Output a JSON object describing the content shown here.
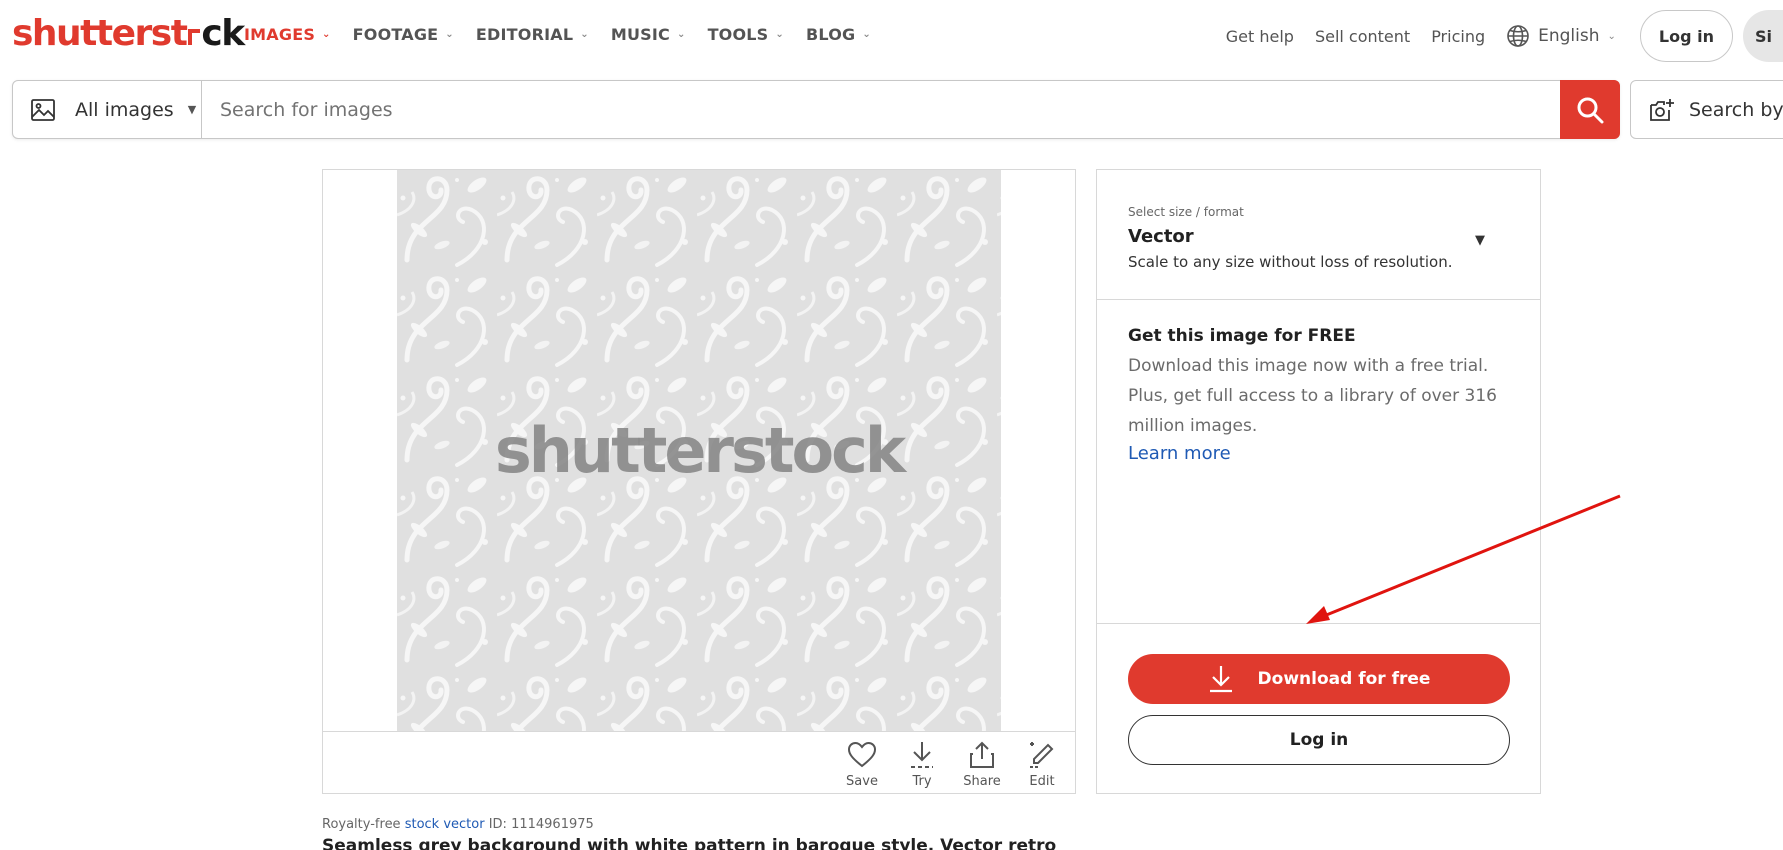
{
  "brand": {
    "logo_start": "shutterst",
    "logo_end": "ck",
    "accent": "#e03a2e"
  },
  "nav": {
    "items": [
      {
        "label": "IMAGES",
        "active": true
      },
      {
        "label": "FOOTAGE",
        "active": false
      },
      {
        "label": "EDITORIAL",
        "active": false
      },
      {
        "label": "MUSIC",
        "active": false
      },
      {
        "label": "TOOLS",
        "active": false
      },
      {
        "label": "BLOG",
        "active": false
      }
    ],
    "chevron": "⌄",
    "get_help": "Get help",
    "sell_content": "Sell content",
    "pricing": "Pricing",
    "language": "English",
    "login": "Log in",
    "signup_partial": "Si"
  },
  "search": {
    "filter_label": "All images",
    "placeholder": "Search for images",
    "search_by_image": "Search by i"
  },
  "preview": {
    "watermark": "shutterstock",
    "actions": {
      "save": "Save",
      "try": "Try",
      "share": "Share",
      "edit": "Edit"
    }
  },
  "license": {
    "size_label": "Select size / format",
    "size_value": "Vector",
    "size_desc": "Scale to any size without loss of resolution.",
    "promo_title": "Get this image for FREE",
    "promo_text": "Download this image now with a free trial. Plus, get full access to a library of over 316 million images.",
    "learn_more": "Learn more",
    "download_btn": "Download for free",
    "login_btn": "Log in"
  },
  "meta": {
    "prefix": "Royalty-free ",
    "type_link": "stock vector",
    "id_text": " ID: 1114961975",
    "title": "Seamless grey background with white pattern in baroque style. Vector retro"
  },
  "colors": {
    "accent": "#e03a2e",
    "link": "#1f5ab4",
    "pattern_bg": "#e0e0e0"
  }
}
